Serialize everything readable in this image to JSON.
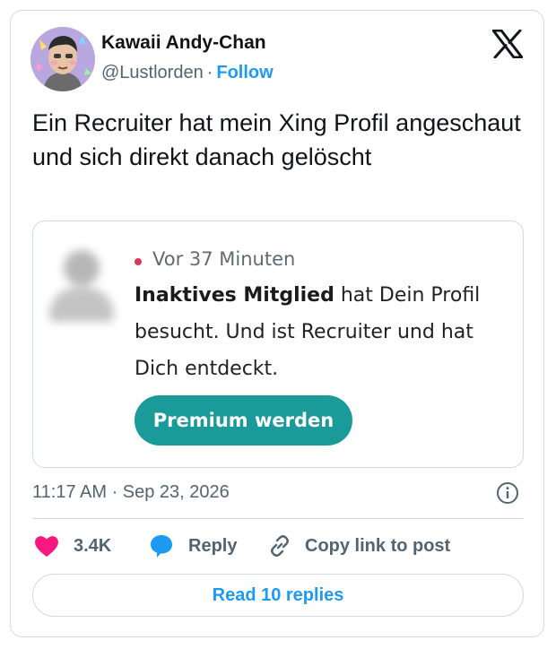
{
  "author": {
    "name": "Kawaii Andy-Chan",
    "handle": "@Lustlorden",
    "separator": "·",
    "follow_label": "Follow"
  },
  "tweet": {
    "text": "Ein Recruiter hat mein Xing Profil angeschaut und sich direkt danach gelöscht"
  },
  "media": {
    "time_ago": "Vor 37 Minuten",
    "member": "Inaktives Mitglied",
    "message": " hat Dein Profil besucht. Und ist Recruiter und hat Dich entdeckt.",
    "button_label": "Premium werden",
    "accent_color": "#1a9a98"
  },
  "meta": {
    "timestamp": "11:17 AM · Sep 23, 2026"
  },
  "actions": {
    "likes": "3.4K",
    "reply_label": "Reply",
    "copy_label": "Copy link to post"
  },
  "footer": {
    "read_replies_label": "Read 10 replies"
  },
  "icons": {
    "platform": "x-logo-icon",
    "like": "heart-icon",
    "reply": "speech-bubble-icon",
    "copy": "link-icon",
    "info": "info-icon"
  },
  "colors": {
    "link": "#1d9bf0",
    "heart": "#f91880",
    "muted": "#536471"
  }
}
